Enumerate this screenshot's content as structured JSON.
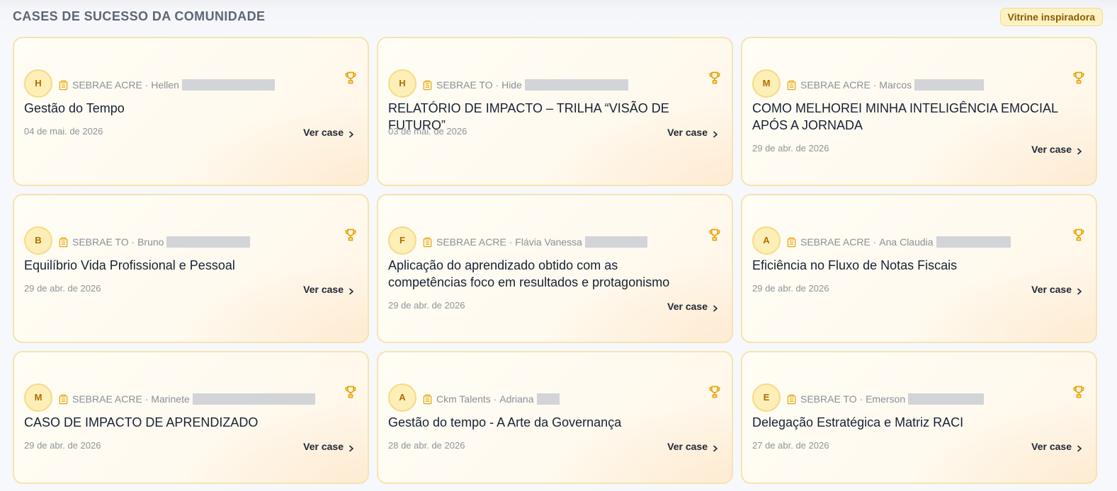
{
  "section": {
    "title": "CASES DE SUCESSO DA COMUNIDADE",
    "badge": "Vitrine inspiradora"
  },
  "colors": {
    "accent": "#f6db86",
    "badge_bg": "#fdf2c4",
    "badge_text": "#8a5b00",
    "trophy": "#e7a300"
  },
  "icons": {
    "org": "building-icon",
    "award": "trophy-icon",
    "more": "chevron-right-icon"
  },
  "cards": [
    {
      "initial": "H",
      "org": "SEBRAE ACRE",
      "author": "Hellen",
      "title": "Gestão do Tempo",
      "date": "04 de mai. de 2026",
      "cta": "Ver case"
    },
    {
      "initial": "H",
      "org": "SEBRAE TO",
      "author": "Hide",
      "title": "RELATÓRIO DE IMPACTO – TRILHA “VISÃO DE FUTURO”",
      "date": "03 de mai. de 2026",
      "cta": "Ver case"
    },
    {
      "initial": "M",
      "org": "SEBRAE ACRE",
      "author": "Marcos",
      "title": "COMO MELHOREI MINHA INTELIGÊNCIA EMOCIAL APÓS A JORNADA",
      "date": "29 de abr. de 2026",
      "cta": "Ver case"
    },
    {
      "initial": "B",
      "org": "SEBRAE TO",
      "author": "Bruno",
      "title": "Equilíbrio Vida Profissional e Pessoal",
      "date": "29 de abr. de 2026",
      "cta": "Ver case"
    },
    {
      "initial": "F",
      "org": "SEBRAE ACRE",
      "author": "Flávia Vanessa",
      "title": "Aplicação do aprendizado obtido com as competências foco em resultados e protagonismo",
      "date": "29 de abr. de 2026",
      "cta": "Ver case"
    },
    {
      "initial": "A",
      "org": "SEBRAE ACRE",
      "author": "Ana Claudia",
      "title": "Eficiência no Fluxo de Notas Fiscais",
      "date": "29 de abr. de 2026",
      "cta": "Ver case"
    },
    {
      "initial": "M",
      "org": "SEBRAE ACRE",
      "author": "Marinete",
      "title": "CASO DE IMPACTO DE APRENDIZADO",
      "date": "29 de abr. de 2026",
      "cta": "Ver case"
    },
    {
      "initial": "A",
      "org": "Ckm Talents",
      "author": "Adriana",
      "title": "Gestão do tempo - A Arte da Governança",
      "date": "28 de abr. de 2026",
      "cta": "Ver case"
    },
    {
      "initial": "E",
      "org": "SEBRAE TO",
      "author": "Emerson",
      "title": "Delegação Estratégica e Matriz RACI",
      "date": "27 de abr. de 2026",
      "cta": "Ver case"
    }
  ]
}
